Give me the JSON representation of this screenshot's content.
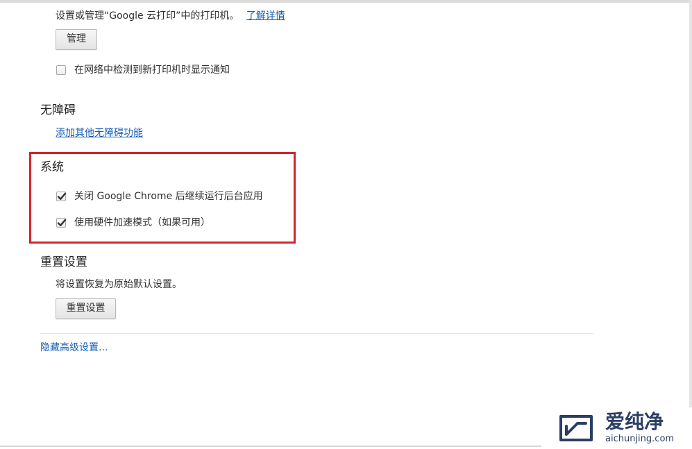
{
  "cloud_print": {
    "description": "设置或管理“Google 云打印”中的打印机。",
    "learn_more_link": "了解详情",
    "manage_button": "管理",
    "notify_checkbox_label": "在网络中检测到新打印机时显示通知",
    "notify_checked": false
  },
  "accessibility": {
    "heading": "无障碍",
    "add_features_link": "添加其他无障碍功能"
  },
  "system": {
    "heading": "系统",
    "items": [
      {
        "label": "关闭 Google Chrome 后继续运行后台应用",
        "checked": true
      },
      {
        "label": "使用硬件加速模式（如果可用）",
        "checked": true
      }
    ],
    "highlight_color": "#d0262f"
  },
  "reset": {
    "heading": "重置设置",
    "description": "将设置恢复为原始默认设置。",
    "button": "重置设置"
  },
  "hide_advanced_link": "隐藏高级设置...",
  "watermark": {
    "name": "爱纯净",
    "domain": "aichunjing.com"
  },
  "colors": {
    "link": "#1a5fb4",
    "text": "#303030",
    "highlight": "#d0262f"
  }
}
